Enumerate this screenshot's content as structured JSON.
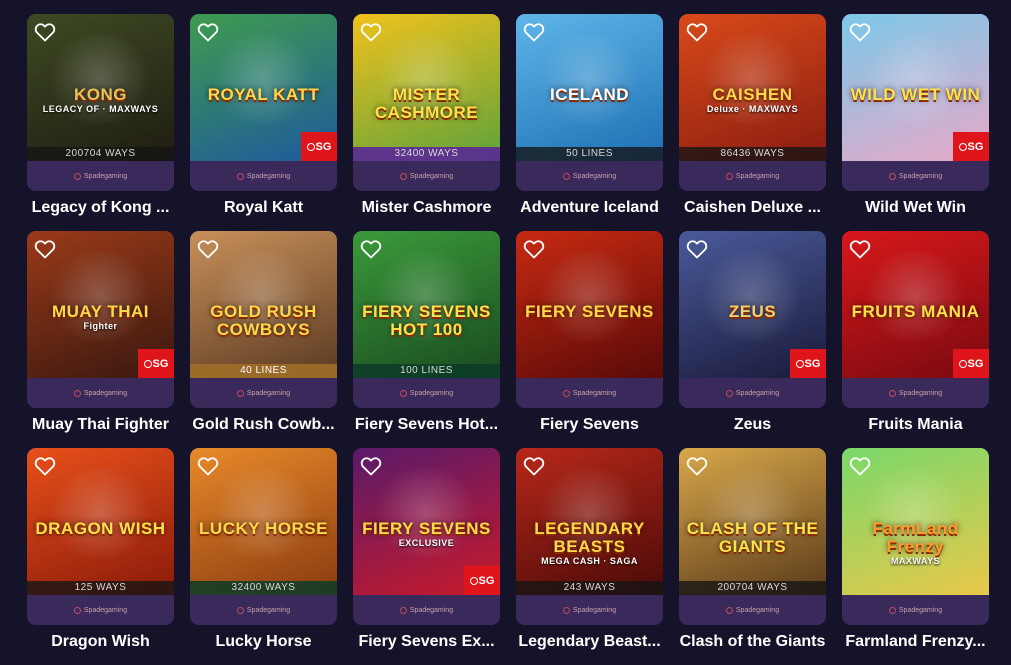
{
  "provider_label": "Spadegaming",
  "badge_label": "SG",
  "games": [
    {
      "title": "Legacy of Kong ...",
      "logo": "KONG",
      "logo_sub": "LEGACY OF · MAXWAYS",
      "ways": "200704 WAYS",
      "ways_style": "dark",
      "sg": false,
      "colors": [
        "#3d4a22",
        "#1f1c12"
      ],
      "logo_color": "#e8c25a"
    },
    {
      "title": "Royal Katt",
      "logo": "ROYAL KATT",
      "logo_sub": "",
      "ways": "",
      "ways_style": "",
      "sg": true,
      "colors": [
        "#3e9b4e",
        "#1d5a9c"
      ],
      "logo_color": "#ffd84a"
    },
    {
      "title": "Mister Cashmore",
      "logo": "MISTER CASHMORE",
      "logo_sub": "",
      "ways": "32400 WAYS",
      "ways_style": "purple",
      "sg": false,
      "colors": [
        "#f0c21d",
        "#5ea23a"
      ],
      "logo_color": "#ffe14a"
    },
    {
      "title": "Adventure Iceland",
      "logo": "ICELAND",
      "logo_sub": "",
      "ways": "50 LINES",
      "ways_style": "dark",
      "sg": false,
      "colors": [
        "#5fb6e8",
        "#1d6fb3"
      ],
      "logo_color": "#ffffff"
    },
    {
      "title": "Caishen Deluxe ...",
      "logo": "CAISHEN",
      "logo_sub": "Deluxe · MAXWAYS",
      "ways": "86436 WAYS",
      "ways_style": "dark",
      "sg": false,
      "colors": [
        "#d94a1a",
        "#8a1c10"
      ],
      "logo_color": "#ffd84a"
    },
    {
      "title": "Wild Wet Win",
      "logo": "WILD WET WIN",
      "logo_sub": "",
      "ways": "",
      "ways_style": "",
      "sg": true,
      "colors": [
        "#7cc8e8",
        "#e8a8c8"
      ],
      "logo_color": "#ffe14a"
    },
    {
      "title": "Muay Thai Fighter",
      "logo": "MUAY THAI",
      "logo_sub": "Fighter",
      "ways": "",
      "ways_style": "",
      "sg": true,
      "colors": [
        "#9a3a18",
        "#3a1810"
      ],
      "logo_color": "#ffd84a"
    },
    {
      "title": "Gold Rush Cowb...",
      "logo": "GOLD RUSH COWBOYS",
      "logo_sub": "",
      "ways": "40 LINES",
      "ways_style": "gold",
      "sg": false,
      "colors": [
        "#c8905a",
        "#5a3a22"
      ],
      "logo_color": "#ffd84a"
    },
    {
      "title": "Fiery Sevens Hot...",
      "logo": "FIERY SEVENS HOT 100",
      "logo_sub": "",
      "ways": "100 LINES",
      "ways_style": "green",
      "sg": false,
      "colors": [
        "#3a9a3a",
        "#1a4a20"
      ],
      "logo_color": "#ffe14a"
    },
    {
      "title": "Fiery Sevens",
      "logo": "FIERY SEVENS",
      "logo_sub": "",
      "ways": "",
      "ways_style": "",
      "sg": false,
      "colors": [
        "#c82a12",
        "#5a0a08"
      ],
      "logo_color": "#ffd84a"
    },
    {
      "title": "Zeus",
      "logo": "ZEUS",
      "logo_sub": "",
      "ways": "",
      "ways_style": "",
      "sg": true,
      "colors": [
        "#4a5a9a",
        "#1a1a3a"
      ],
      "logo_color": "#f0d070"
    },
    {
      "title": "Fruits Mania",
      "logo": "FRUITS MANIA",
      "logo_sub": "",
      "ways": "",
      "ways_style": "",
      "sg": true,
      "colors": [
        "#d8181a",
        "#7a0a10"
      ],
      "logo_color": "#ffe14a"
    },
    {
      "title": "Dragon Wish",
      "logo": "DRAGON WISH",
      "logo_sub": "",
      "ways": "125 WAYS",
      "ways_style": "dark",
      "sg": false,
      "colors": [
        "#e8501a",
        "#8a1a0a"
      ],
      "logo_color": "#ffe14a"
    },
    {
      "title": "Lucky Horse",
      "logo": "LUCKY HORSE",
      "logo_sub": "",
      "ways": "32400 WAYS",
      "ways_style": "green",
      "sg": false,
      "colors": [
        "#e88a2a",
        "#8a3a10"
      ],
      "logo_color": "#ffd84a"
    },
    {
      "title": "Fiery Sevens Ex...",
      "logo": "FIERY SEVENS",
      "logo_sub": "EXCLUSIVE",
      "ways": "",
      "ways_style": "",
      "sg": true,
      "colors": [
        "#5a1a6a",
        "#c81a2a"
      ],
      "logo_color": "#ffd84a"
    },
    {
      "title": "Legendary Beast...",
      "logo": "LEGENDARY BEASTS",
      "logo_sub": "MEGA CASH · SAGA",
      "ways": "243 WAYS",
      "ways_style": "dark",
      "sg": false,
      "colors": [
        "#b8281a",
        "#4a0a08"
      ],
      "logo_color": "#ffd84a"
    },
    {
      "title": "Clash of the Giants",
      "logo": "CLASH OF THE GIANTS",
      "logo_sub": "",
      "ways": "200704 WAYS",
      "ways_style": "dark",
      "sg": false,
      "colors": [
        "#d8a84a",
        "#5a3a1a"
      ],
      "logo_color": "#ffe14a"
    },
    {
      "title": "Farmland Frenzy...",
      "logo": "FarmLand Frenzy",
      "logo_sub": "MAXWAYS",
      "ways": "",
      "ways_style": "",
      "sg": false,
      "colors": [
        "#7ad86a",
        "#e8c84a"
      ],
      "logo_color": "#ff9a2a"
    }
  ]
}
